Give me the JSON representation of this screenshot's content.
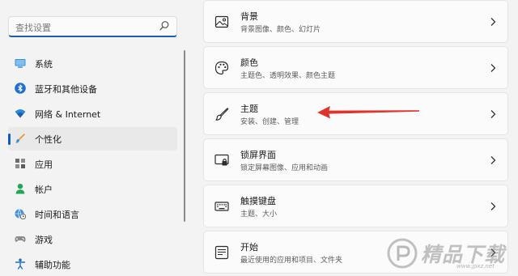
{
  "search": {
    "placeholder": "查找设置"
  },
  "nav": {
    "items": [
      {
        "label": "系统",
        "icon": "monitor-icon"
      },
      {
        "label": "蓝牙和其他设备",
        "icon": "bluetooth-icon"
      },
      {
        "label": "网络 & Internet",
        "icon": "wifi-icon"
      },
      {
        "label": "个性化",
        "icon": "brush-icon",
        "active": true
      },
      {
        "label": "应用",
        "icon": "apps-icon"
      },
      {
        "label": "帐户",
        "icon": "account-icon"
      },
      {
        "label": "时间和语言",
        "icon": "globe-clock-icon"
      },
      {
        "label": "游戏",
        "icon": "gamepad-icon"
      },
      {
        "label": "辅助功能",
        "icon": "accessibility-icon"
      }
    ]
  },
  "cards": [
    {
      "title": "背景",
      "subtitle": "背景图像、颜色、幻灯片",
      "icon": "image-icon"
    },
    {
      "title": "颜色",
      "subtitle": "主题色、透明效果、颜色主题",
      "icon": "palette-icon"
    },
    {
      "title": "主题",
      "subtitle": "安装、创建、管理",
      "icon": "brush-icon"
    },
    {
      "title": "锁屏界面",
      "subtitle": "锁定屏幕图像、应用和动画",
      "icon": "lock-screen-icon"
    },
    {
      "title": "触摸键盘",
      "subtitle": "主题、大小",
      "icon": "keyboard-icon"
    },
    {
      "title": "开始",
      "subtitle": "最近使用的应用和项目、文件夹",
      "icon": "start-menu-icon"
    }
  ],
  "annotation": {
    "color": "#e0332b"
  },
  "watermark": {
    "text": "精品下载",
    "url": "www.jpxz.net"
  },
  "colors": {
    "accent": "#0a5dc2",
    "background": "#f3f3f3",
    "card": "#fbfbfb"
  }
}
